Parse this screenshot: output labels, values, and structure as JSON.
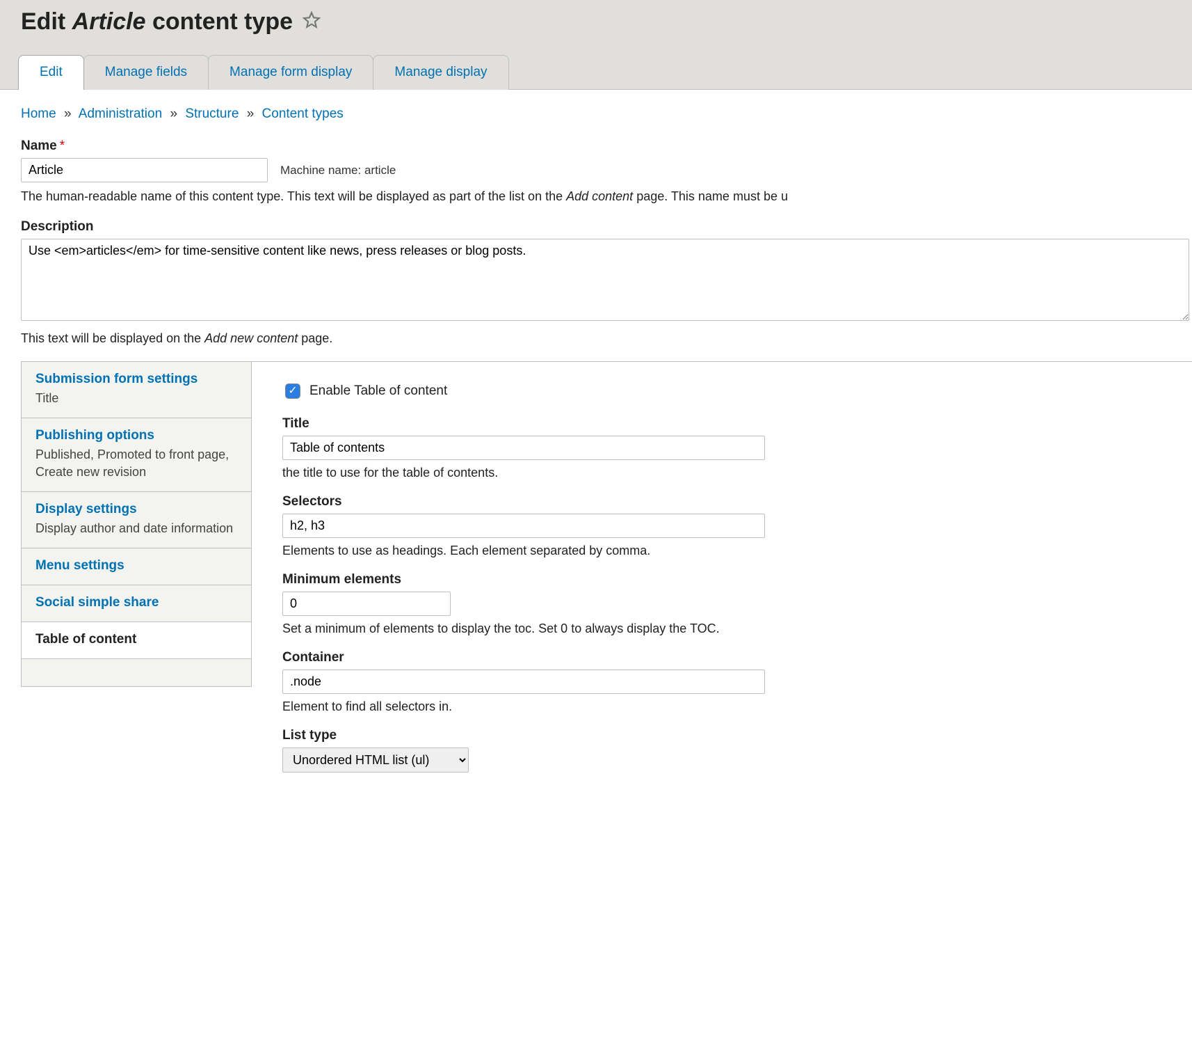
{
  "page_title": {
    "prefix": "Edit ",
    "emphasis": "Article",
    "suffix": " content type"
  },
  "tabs": [
    {
      "label": "Edit",
      "active": true
    },
    {
      "label": "Manage fields",
      "active": false
    },
    {
      "label": "Manage form display",
      "active": false
    },
    {
      "label": "Manage display",
      "active": false
    }
  ],
  "breadcrumb": {
    "items": [
      "Home",
      "Administration",
      "Structure",
      "Content types"
    ],
    "sep": "»"
  },
  "name_field": {
    "label": "Name",
    "value": "Article",
    "machine_label": "Machine name:",
    "machine_value": "article",
    "help_pre": "The human-readable name of this content type. This text will be displayed as part of the list on the ",
    "help_em": "Add content",
    "help_post": " page. This name must be u"
  },
  "description_field": {
    "label": "Description",
    "value": "Use <em>articles</em> for time-sensitive content like news, press releases or blog posts.",
    "help_pre": "This text will be displayed on the ",
    "help_em": "Add new content",
    "help_post": " page."
  },
  "vtabs": [
    {
      "title": "Submission form settings",
      "sub": "Title"
    },
    {
      "title": "Publishing options",
      "sub": "Published, Promoted to front page, Create new revision"
    },
    {
      "title": "Display settings",
      "sub": "Display author and date information"
    },
    {
      "title": "Menu settings",
      "sub": ""
    },
    {
      "title": "Social simple share",
      "sub": ""
    },
    {
      "title": "Table of content",
      "sub": "",
      "active": true
    }
  ],
  "toc": {
    "enable_label": "Enable Table of content",
    "enable_checked": true,
    "title_label": "Title",
    "title_value": "Table of contents",
    "title_help": "the title to use for the table of contents.",
    "selectors_label": "Selectors",
    "selectors_value": "h2, h3",
    "selectors_help": "Elements to use as headings. Each element separated by comma.",
    "min_label": "Minimum elements",
    "min_value": "0",
    "min_help": "Set a minimum of elements to display the toc. Set 0 to always display the TOC.",
    "container_label": "Container",
    "container_value": ".node",
    "container_help": "Element to find all selectors in.",
    "listtype_label": "List type",
    "listtype_value": "Unordered HTML list (ul)"
  }
}
